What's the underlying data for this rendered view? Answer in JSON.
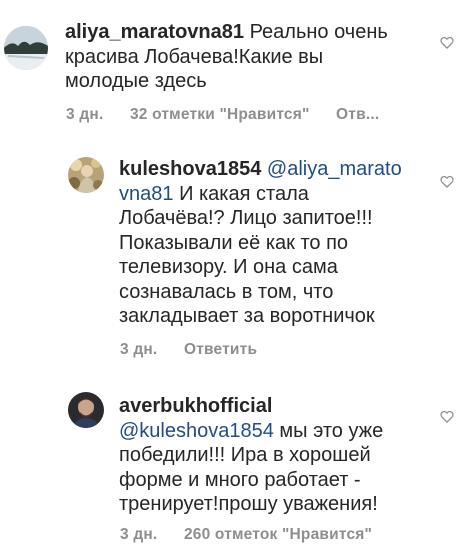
{
  "comments": [
    {
      "username": "aliya_maratovna81",
      "mention": "",
      "text": "Реально очень красива Лобачева!Какие вы молодые здесь",
      "time": "3 дн.",
      "likes": "32 отметки \"Нравится\"",
      "reply": "Отв..."
    },
    {
      "username": "kuleshova1854",
      "mention": "@aliya_maratovna81",
      "text": "И какая стала Лобачёва!? Лицо запитое!!! Показывали её как то по телевизору. И она сама сознавалась в том, что закладывает за воротничок",
      "time": "3 дн.",
      "likes": "",
      "reply": "Ответить"
    },
    {
      "username": "averbukhofficial",
      "mention": "@kuleshova1854",
      "text": "мы это уже победили!!! Ира в хорошей форме и много работает - тренирует!прошу уважения!",
      "time": "3 дн.",
      "likes": "260 отметок \"Нравится\"",
      "reply": ""
    }
  ],
  "icons": {
    "like": "heart-icon"
  },
  "colors": {
    "text": "#262626",
    "meta": "#8e8e8e",
    "mention": "#1f4d86"
  }
}
